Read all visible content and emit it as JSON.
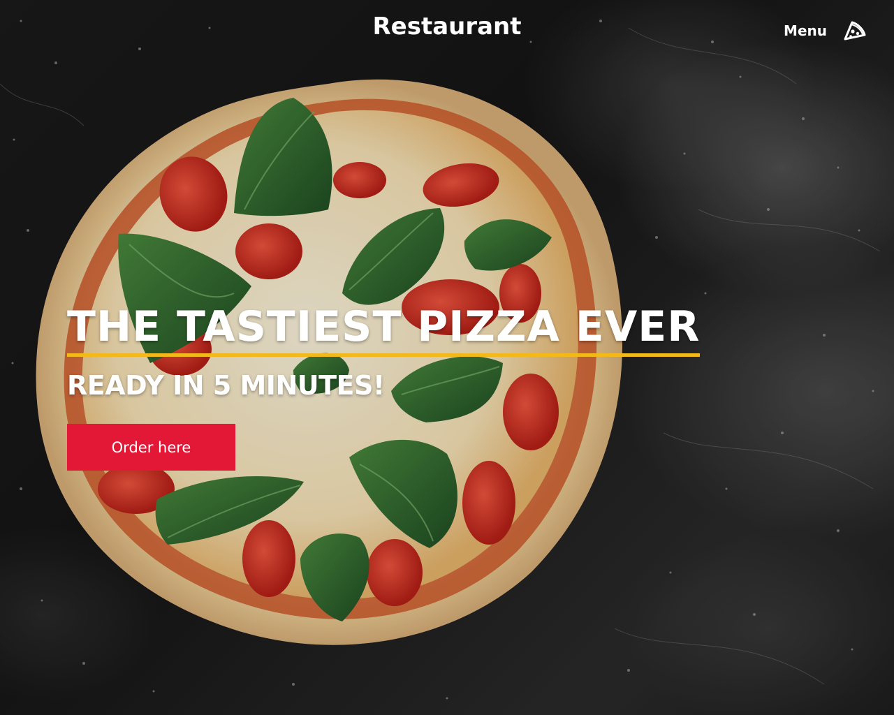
{
  "header": {
    "brand": "Restaurant",
    "menu_label": "Menu",
    "menu_icon": "pizza-slice-icon"
  },
  "hero": {
    "title": "THE TASTIEST PIZZA EVER",
    "subtitle": "READY IN 5 MINUTES!",
    "cta_label": "Order here",
    "background_image": "pizza-on-dark-floured-surface"
  },
  "colors": {
    "accent_underline": "#f3b81a",
    "cta_background": "#e31837",
    "text": "#ffffff",
    "background": "#141414"
  }
}
